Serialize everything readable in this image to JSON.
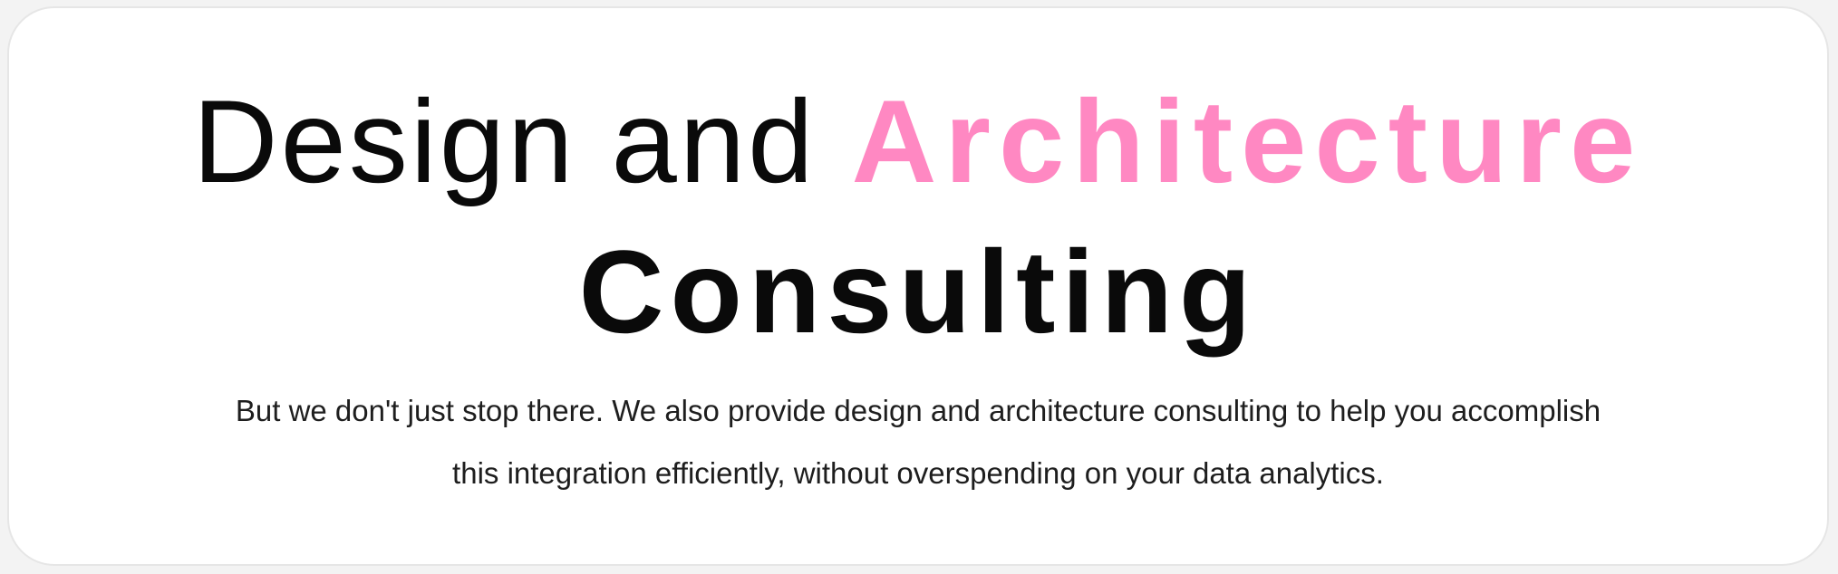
{
  "heading": {
    "line1_plain": "Design and ",
    "line1_accent": "Architecture",
    "line2": "Consulting"
  },
  "body": {
    "lines": [
      "But we don't just stop there. We also provide design and architecture consulting to help you accomplish",
      "this integration efficiently, without overspending on your data analytics."
    ]
  },
  "colors": {
    "accent": "#ff88c2",
    "text": "#0a0a0a"
  }
}
